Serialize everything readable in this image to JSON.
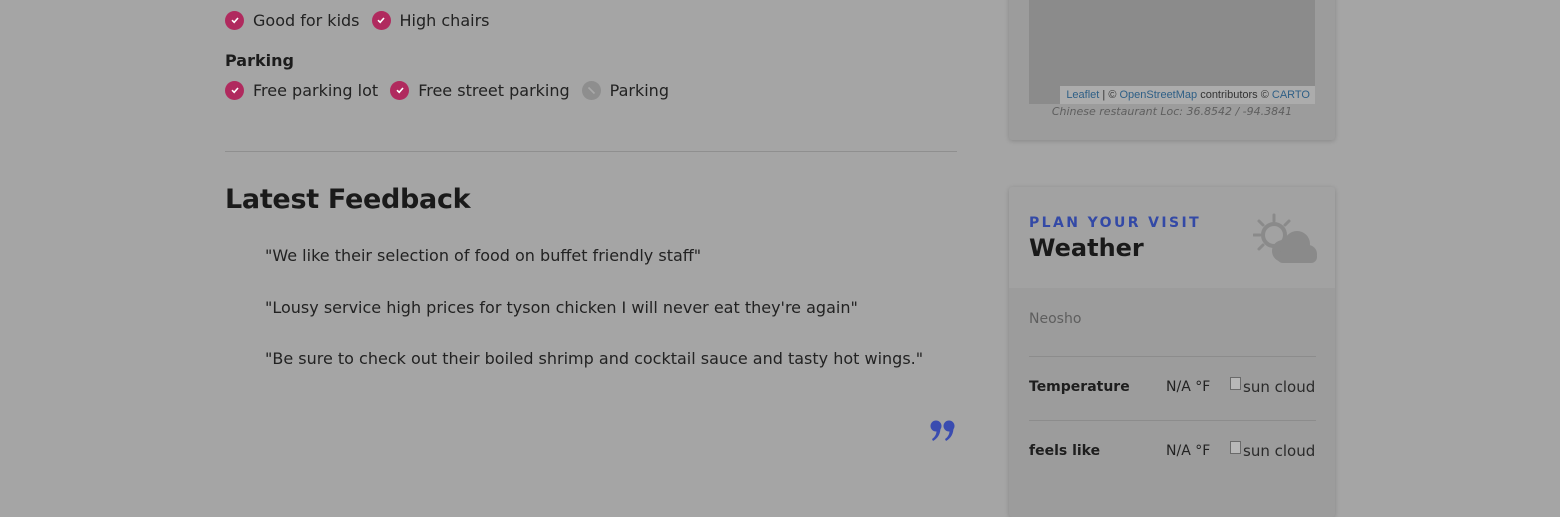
{
  "amenities": {
    "children_row": [
      {
        "label": "Good for kids",
        "available": true
      },
      {
        "label": "High chairs",
        "available": true
      }
    ],
    "parking_title": "Parking",
    "parking_row": [
      {
        "label": "Free parking lot",
        "available": true
      },
      {
        "label": "Free street parking",
        "available": true
      },
      {
        "label": "Parking",
        "available": false
      }
    ]
  },
  "feedback": {
    "title": "Latest Feedback",
    "quotes": [
      "\"We like their selection of food on buffet friendly staff\"",
      "\"Lousy service high prices for tyson chicken I will never eat they're again\"",
      "\"Be sure to check out their boiled shrimp and cocktail sauce and tasty hot wings.\""
    ]
  },
  "map": {
    "attribution": {
      "leaflet": "Leaflet",
      "sep": " | © ",
      "osm": "OpenStreetMap",
      "contrib": " contributors © ",
      "carto": "CARTO"
    },
    "caption": "Chinese restaurant Loc: 36.8542 / -94.3841"
  },
  "weather": {
    "eyebrow": "PLAN YOUR VISIT",
    "title": "Weather",
    "icon": "sun-cloud-icon",
    "city": "Neosho",
    "rows": [
      {
        "label": "Temperature",
        "value": "N/A °F",
        "img_alt": "sun cloud"
      },
      {
        "label": "feels like",
        "value": "N/A °F",
        "img_alt": "sun cloud"
      }
    ]
  },
  "colors": {
    "check_on": "#b02a5e",
    "check_off": "#8e8e8e",
    "accent_blue": "#3349a6"
  }
}
